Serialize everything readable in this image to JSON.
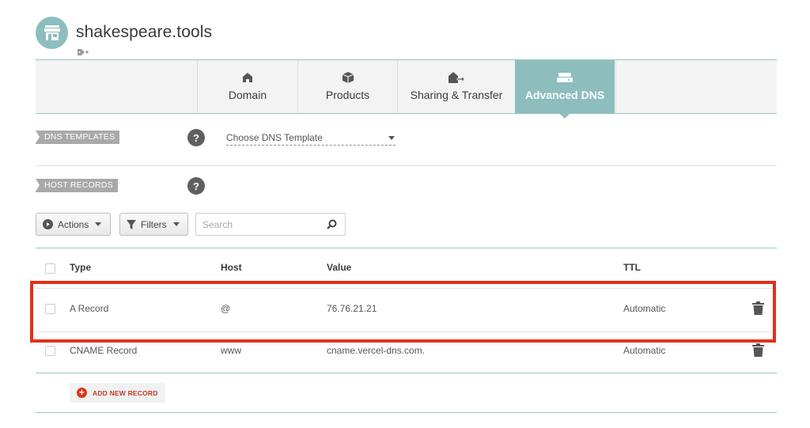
{
  "header": {
    "domain": "shakespeare.tools",
    "avatar_icon": "store-icon",
    "tag_icon": "add-tag-icon"
  },
  "tabs": [
    {
      "label": "Domain",
      "icon": "home-icon",
      "active": false
    },
    {
      "label": "Products",
      "icon": "box-icon",
      "active": false
    },
    {
      "label": "Sharing & Transfer",
      "icon": "transfer-icon",
      "active": false
    },
    {
      "label": "Advanced DNS",
      "icon": "server-icon",
      "active": true
    }
  ],
  "dns_templates": {
    "label": "DNS TEMPLATES",
    "help": "?",
    "select_value": "Choose DNS Template"
  },
  "host_records": {
    "label": "HOST RECORDS",
    "help": "?"
  },
  "toolbar": {
    "actions_label": "Actions",
    "filters_label": "Filters",
    "search_placeholder": "Search"
  },
  "table": {
    "columns": [
      "Type",
      "Host",
      "Value",
      "TTL"
    ],
    "rows": [
      {
        "type": "A Record",
        "host": "@",
        "value": "76.76.21.21",
        "ttl": "Automatic",
        "highlighted": true
      },
      {
        "type": "CNAME Record",
        "host": "www",
        "value": "cname.vercel-dns.com.",
        "ttl": "Automatic",
        "highlighted": false
      }
    ],
    "add_label": "ADD NEW RECORD"
  },
  "colors": {
    "accent": "#8dbdbd",
    "highlight": "#e0311e",
    "add": "#d8341e"
  }
}
